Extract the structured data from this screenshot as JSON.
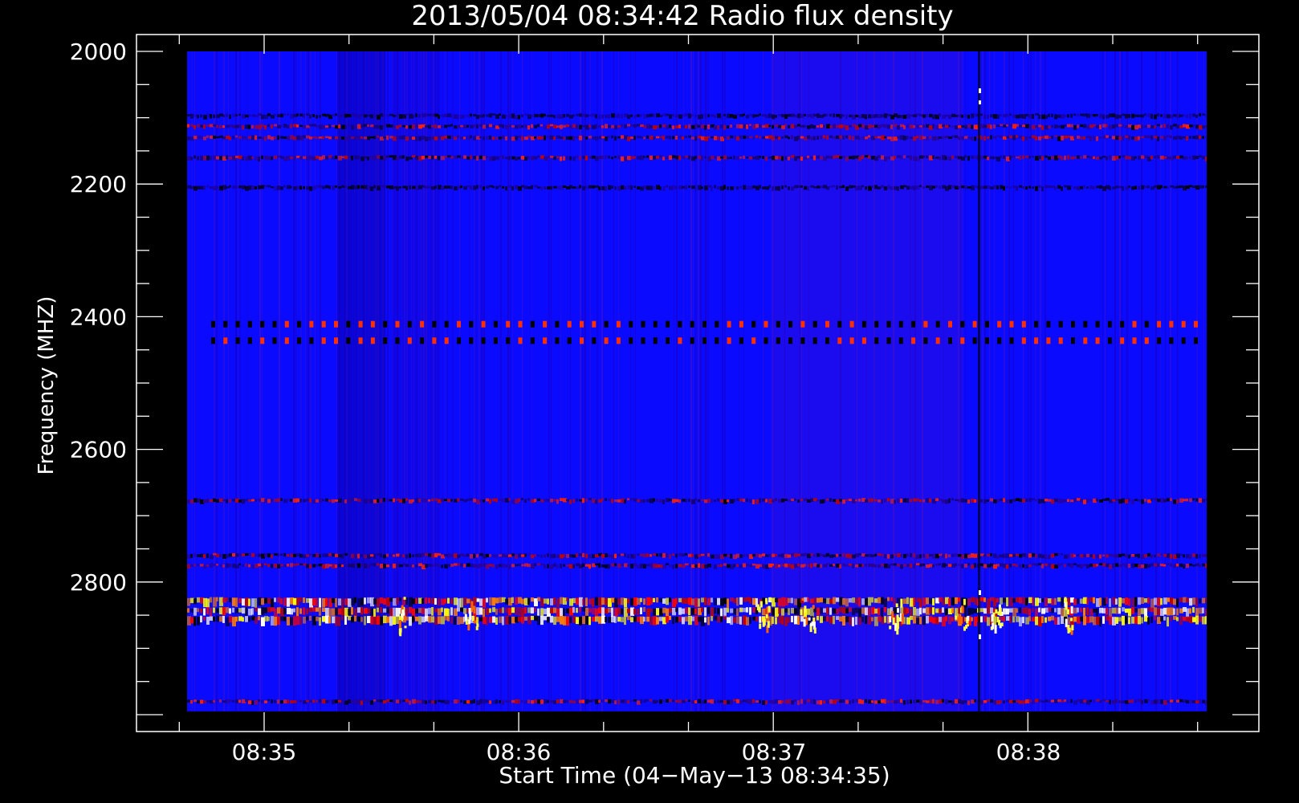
{
  "chart_data": {
    "type": "heatmap",
    "title": "2013/05/04 08:34:42 Radio flux density",
    "xlabel": "Start Time (04−May−13 08:34:35)",
    "ylabel": "Frequency (MHZ)",
    "x_ticks": [
      "08:35",
      "08:36",
      "08:37",
      "08:38"
    ],
    "y_ticks": [
      2000,
      2200,
      2400,
      2600,
      2800
    ],
    "y_range": [
      2000,
      3000
    ],
    "y_reversed": true,
    "y_data_extent": [
      2000,
      2995
    ],
    "colormap": [
      "#000000",
      "#0000ff",
      "#ff0000",
      "#ffff00",
      "#ffffff"
    ],
    "background_color": "#0a0aff",
    "frame_color": "#ffffff",
    "features": [
      {
        "kind": "horizontal_band",
        "freq_mhz": 2097,
        "intensity": "low"
      },
      {
        "kind": "horizontal_band",
        "freq_mhz": 2113,
        "intensity": "mixed"
      },
      {
        "kind": "horizontal_band",
        "freq_mhz": 2130,
        "intensity": "mixed"
      },
      {
        "kind": "horizontal_band",
        "freq_mhz": 2160,
        "intensity": "mixed"
      },
      {
        "kind": "horizontal_band",
        "freq_mhz": 2205,
        "intensity": "low"
      },
      {
        "kind": "horizontal_band",
        "freq_mhz": 2410,
        "intensity": "dotted"
      },
      {
        "kind": "horizontal_band",
        "freq_mhz": 2435,
        "intensity": "dotted"
      },
      {
        "kind": "horizontal_band",
        "freq_mhz": 2677,
        "intensity": "mixed"
      },
      {
        "kind": "horizontal_band",
        "freq_mhz": 2760,
        "intensity": "mixed"
      },
      {
        "kind": "horizontal_band",
        "freq_mhz": 2775,
        "intensity": "mixed"
      },
      {
        "kind": "horizontal_band",
        "freq_mhz": 2830,
        "intensity": "high"
      },
      {
        "kind": "horizontal_band",
        "freq_mhz": 2845,
        "intensity": "high"
      },
      {
        "kind": "horizontal_band",
        "freq_mhz": 2858,
        "intensity": "high"
      },
      {
        "kind": "horizontal_band",
        "freq_mhz": 2980,
        "intensity": "mixed"
      }
    ]
  }
}
